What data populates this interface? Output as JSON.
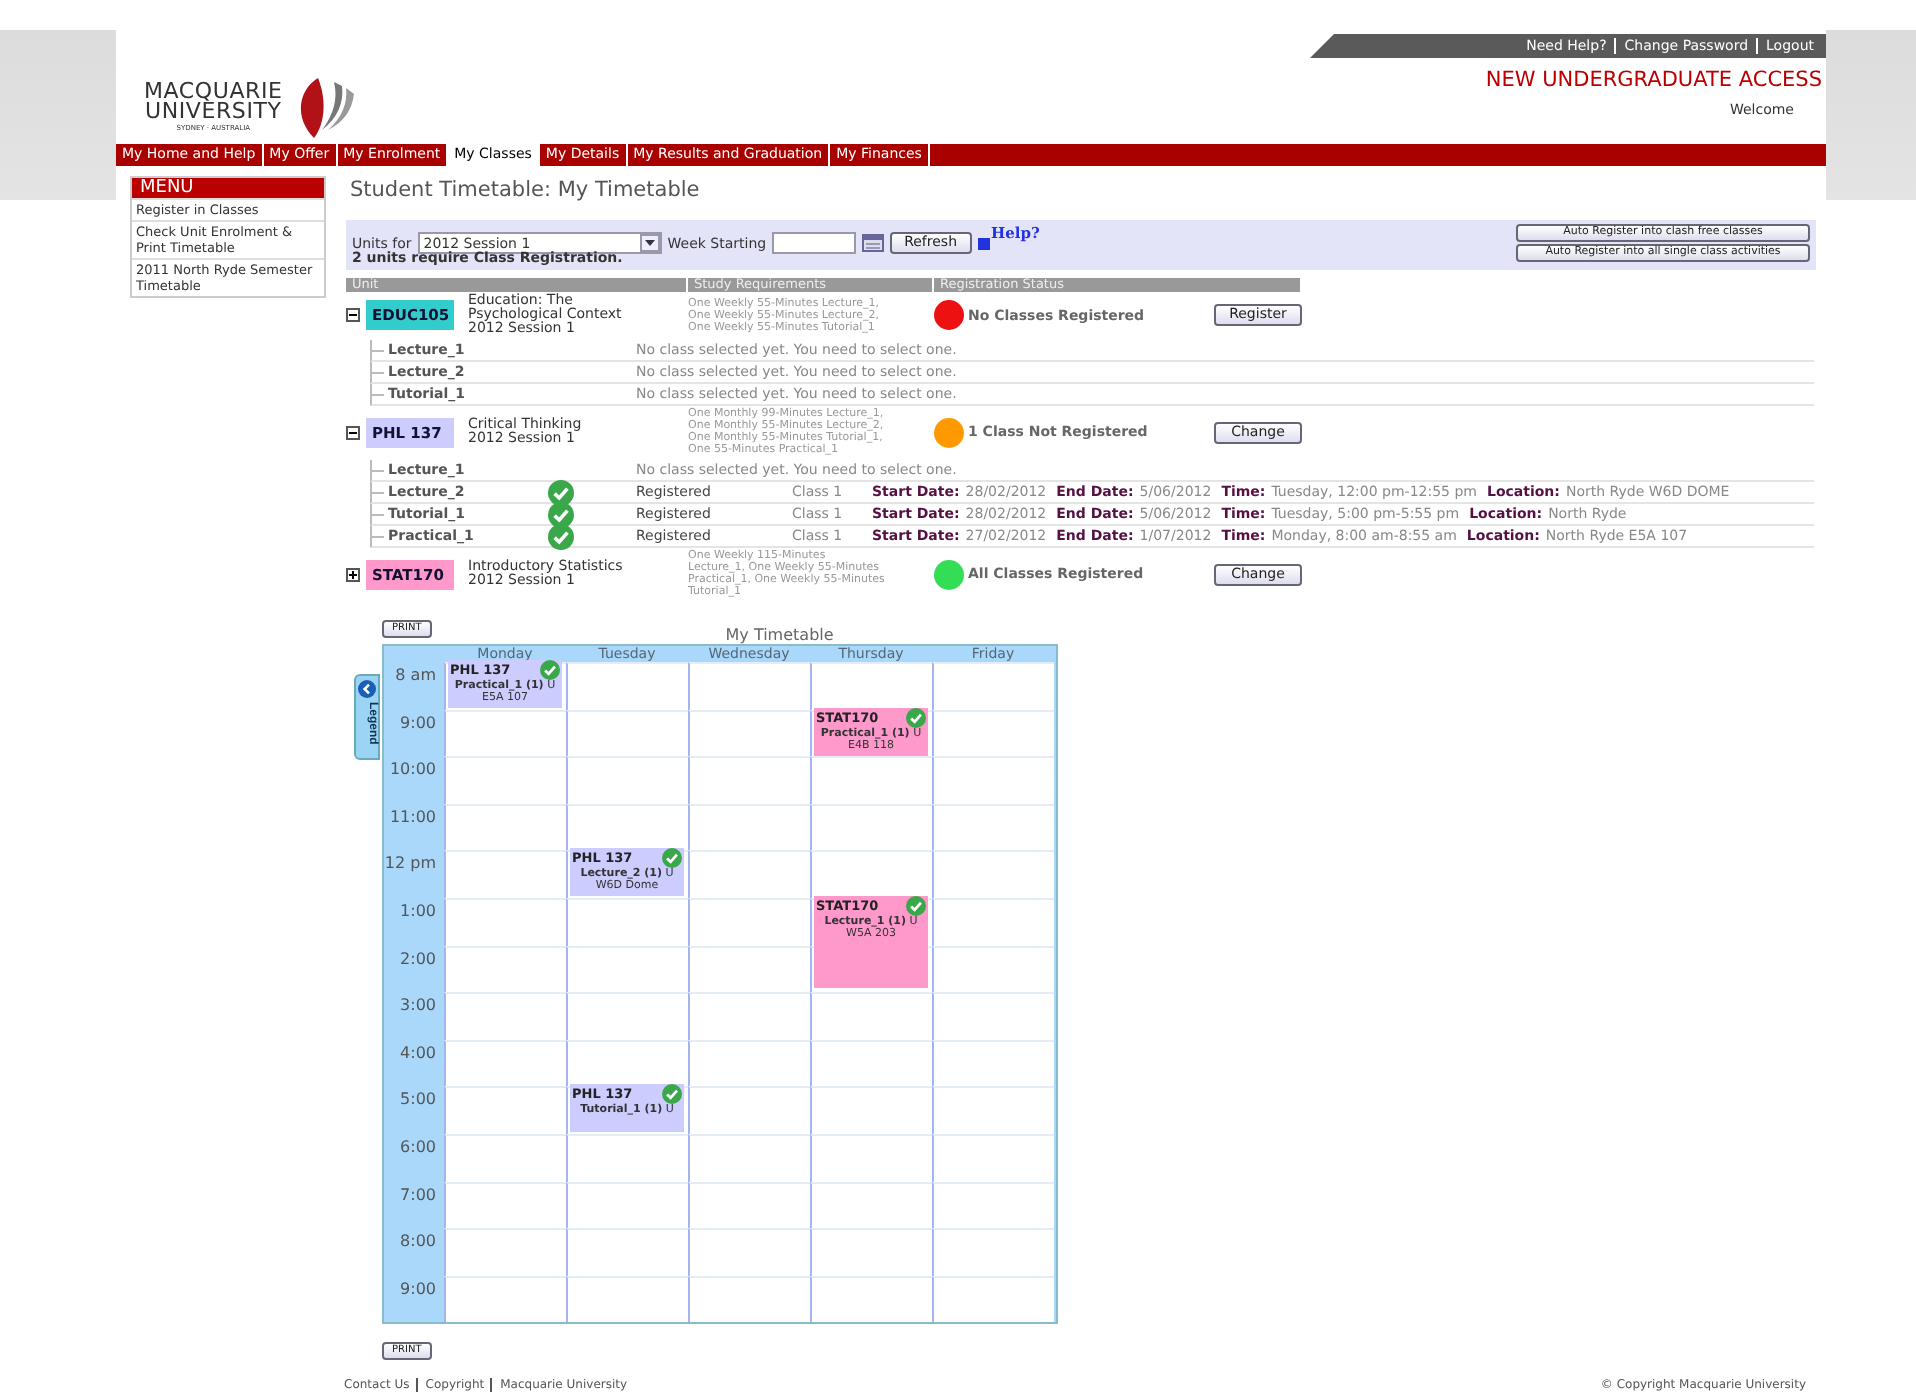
{
  "header": {
    "logo": [
      "MACQUARIE",
      "UNIVERSITY",
      "SYDNEY · AUSTRALIA"
    ],
    "top_links": [
      "Need Help?",
      "Change Password",
      "Logout"
    ],
    "portal_title": "NEW UNDERGRADUATE ACCESS",
    "welcome": "Welcome"
  },
  "nav": [
    {
      "label": "My Home and Help",
      "selected": false
    },
    {
      "label": "My Offer",
      "selected": false
    },
    {
      "label": "My Enrolment",
      "selected": false
    },
    {
      "label": "My Classes",
      "selected": true
    },
    {
      "label": "My Details",
      "selected": false
    },
    {
      "label": "My Results and Graduation",
      "selected": false
    },
    {
      "label": "My Finances",
      "selected": false
    }
  ],
  "menu": {
    "title": "MENU",
    "items": [
      "Register in Classes",
      "Check Unit Enrolment & Print Timetable",
      "2011 North Ryde Semester Timetable"
    ]
  },
  "page_title": "Student Timetable: My Timetable",
  "filter": {
    "units_label": "Units for",
    "session": "2012 Session 1",
    "week_label": "Week Starting",
    "refresh": "Refresh",
    "help": "Help?",
    "notice": "2 units require Class Registration.",
    "auto_buttons": [
      "Auto Register into clash free classes",
      "Auto Register into all single class activities"
    ]
  },
  "table": {
    "columns": [
      "Unit",
      "Study Requirements",
      "Registration Status"
    ],
    "units": [
      {
        "code": "EDUC105",
        "color": "#33cccc",
        "title": [
          "Education: The",
          "Psychological Context",
          "2012 Session 1"
        ],
        "expanded": true,
        "requirements": [
          "One Weekly 55-Minutes Lecture_1,",
          "One Weekly 55-Minutes Lecture_2,",
          "One Weekly 55-Minutes Tutorial_1"
        ],
        "status": {
          "text": "No Classes Registered",
          "color": "#ee1111"
        },
        "button": "Register",
        "activities": [
          {
            "name": "Lecture_1",
            "registered": false,
            "message": "No class selected yet. You need to select one."
          },
          {
            "name": "Lecture_2",
            "registered": false,
            "message": "No class selected yet. You need to select one."
          },
          {
            "name": "Tutorial_1",
            "registered": false,
            "message": "No class selected yet. You need to select one."
          }
        ]
      },
      {
        "code": "PHL 137",
        "color": "#ccccff",
        "title": [
          "Critical Thinking",
          "2012 Session 1"
        ],
        "expanded": true,
        "requirements": [
          "One Monthly 99-Minutes Lecture_1,",
          "One Monthly 55-Minutes Lecture_2,",
          "One Monthly 55-Minutes Tutorial_1,",
          "One 55-Minutes Practical_1"
        ],
        "status": {
          "text": "1 Class Not Registered",
          "color": "#ff9900"
        },
        "button": "Change",
        "activities": [
          {
            "name": "Lecture_1",
            "registered": false,
            "message": "No class selected yet. You need to select one."
          },
          {
            "name": "Lecture_2",
            "registered": true,
            "status": "Registered",
            "class": "Class 1",
            "details": [
              {
                "label": "Start Date:",
                "value": "28/02/2012"
              },
              {
                "label": "End Date:",
                "value": "5/06/2012"
              },
              {
                "label": "Time:",
                "value": "Tuesday, 12:00 pm-12:55 pm"
              },
              {
                "label": "Location:",
                "value": "North Ryde W6D DOME"
              }
            ]
          },
          {
            "name": "Tutorial_1",
            "registered": true,
            "status": "Registered",
            "class": "Class 1",
            "details": [
              {
                "label": "Start Date:",
                "value": "28/02/2012"
              },
              {
                "label": "End Date:",
                "value": "5/06/2012"
              },
              {
                "label": "Time:",
                "value": "Tuesday, 5:00 pm-5:55 pm"
              },
              {
                "label": "Location:",
                "value": "North Ryde"
              }
            ]
          },
          {
            "name": "Practical_1",
            "registered": true,
            "status": "Registered",
            "class": "Class 1",
            "details": [
              {
                "label": "Start Date:",
                "value": "27/02/2012"
              },
              {
                "label": "End Date:",
                "value": "1/07/2012"
              },
              {
                "label": "Time:",
                "value": "Monday, 8:00 am-8:55 am"
              },
              {
                "label": "Location:",
                "value": "North Ryde E5A 107"
              }
            ]
          }
        ]
      },
      {
        "code": "STAT170",
        "color": "#ff99cc",
        "title": [
          "Introductory Statistics",
          "2012 Session 1"
        ],
        "expanded": false,
        "requirements": [
          "One Weekly 115-Minutes",
          "Lecture_1, One Weekly 55-Minutes",
          "Practical_1, One Weekly 55-Minutes",
          "Tutorial_1"
        ],
        "status": {
          "text": "All Classes Registered",
          "color": "#33dd55"
        },
        "button": "Change"
      }
    ]
  },
  "timetable": {
    "print_top": "PRINT",
    "caption": "My Timetable",
    "legend": "Legend",
    "days": [
      "Monday",
      "Tuesday",
      "Wednesday",
      "Thursday",
      "Friday"
    ],
    "rows": [
      {
        "time": "8 am",
        "cells": [
          {
            "kind": "event",
            "code": "PHL 137",
            "activity": "Practical_1 (1)",
            "location": "U E5A 107",
            "color": "#ccccff",
            "registered": true
          },
          {
            "kind": "empty"
          },
          {
            "kind": "empty"
          },
          {
            "kind": "empty"
          },
          {
            "kind": "empty"
          }
        ]
      },
      {
        "time": "9:00",
        "cells": [
          {
            "kind": "empty"
          },
          {
            "kind": "empty"
          },
          {
            "kind": "empty"
          },
          {
            "kind": "event",
            "code": "STAT170",
            "activity": "Practical_1 (1)",
            "location": "U E4B 118",
            "color": "#ff99cc",
            "registered": true
          },
          {
            "kind": "empty"
          }
        ]
      },
      {
        "time": "10:00",
        "cells": [
          {
            "kind": "empty"
          },
          {
            "kind": "empty"
          },
          {
            "kind": "empty"
          },
          {
            "kind": "empty"
          },
          {
            "kind": "empty"
          }
        ]
      },
      {
        "time": "11:00",
        "cells": [
          {
            "kind": "empty"
          },
          {
            "kind": "empty"
          },
          {
            "kind": "empty"
          },
          {
            "kind": "empty"
          },
          {
            "kind": "empty"
          }
        ]
      },
      {
        "time": "12 pm",
        "cells": [
          {
            "kind": "empty"
          },
          {
            "kind": "event",
            "code": "PHL 137",
            "activity": "Lecture_2 (1)",
            "location": "U W6D Dome",
            "color": "#ccccff",
            "registered": true
          },
          {
            "kind": "empty"
          },
          {
            "kind": "empty"
          },
          {
            "kind": "empty"
          }
        ]
      },
      {
        "time": "1:00",
        "cells": [
          {
            "kind": "empty"
          },
          {
            "kind": "empty"
          },
          {
            "kind": "empty"
          },
          {
            "kind": "event_2h",
            "code": "STAT170",
            "activity": "Lecture_1 (1)",
            "location": "U W5A 203",
            "color": "#ff99cc",
            "registered": true
          },
          {
            "kind": "empty"
          }
        ]
      },
      {
        "time": "2:00",
        "cells": [
          {
            "kind": "empty"
          },
          {
            "kind": "empty"
          },
          {
            "kind": "empty"
          },
          {
            "kind": "empty"
          },
          {
            "kind": "empty"
          }
        ]
      },
      {
        "time": "3:00",
        "cells": [
          {
            "kind": "empty"
          },
          {
            "kind": "empty"
          },
          {
            "kind": "empty"
          },
          {
            "kind": "empty"
          },
          {
            "kind": "empty"
          }
        ]
      },
      {
        "time": "4:00",
        "cells": [
          {
            "kind": "empty"
          },
          {
            "kind": "empty"
          },
          {
            "kind": "empty"
          },
          {
            "kind": "empty"
          },
          {
            "kind": "empty"
          }
        ]
      },
      {
        "time": "5:00",
        "cells": [
          {
            "kind": "empty"
          },
          {
            "kind": "event",
            "code": "PHL 137",
            "activity": "Tutorial_1 (1)",
            "location": "U",
            "color": "#ccccff",
            "registered": true
          },
          {
            "kind": "empty"
          },
          {
            "kind": "empty"
          },
          {
            "kind": "empty"
          }
        ]
      },
      {
        "time": "6:00",
        "cells": [
          {
            "kind": "empty"
          },
          {
            "kind": "empty"
          },
          {
            "kind": "empty"
          },
          {
            "kind": "empty"
          },
          {
            "kind": "empty"
          }
        ]
      },
      {
        "time": "7:00",
        "cells": [
          {
            "kind": "empty"
          },
          {
            "kind": "empty"
          },
          {
            "kind": "empty"
          },
          {
            "kind": "empty"
          },
          {
            "kind": "empty"
          }
        ]
      },
      {
        "time": "8:00",
        "cells": [
          {
            "kind": "empty"
          },
          {
            "kind": "empty"
          },
          {
            "kind": "empty"
          },
          {
            "kind": "empty"
          },
          {
            "kind": "empty"
          }
        ]
      },
      {
        "time": "9:00",
        "cells": [
          {
            "kind": "empty"
          },
          {
            "kind": "empty"
          },
          {
            "kind": "empty"
          },
          {
            "kind": "empty"
          },
          {
            "kind": "empty"
          }
        ]
      }
    ],
    "print_bottom": "PRINT"
  },
  "footer": {
    "links": [
      "Contact Us",
      "Copyright",
      "Macquarie University"
    ],
    "copyright": "© Copyright Macquarie University"
  }
}
